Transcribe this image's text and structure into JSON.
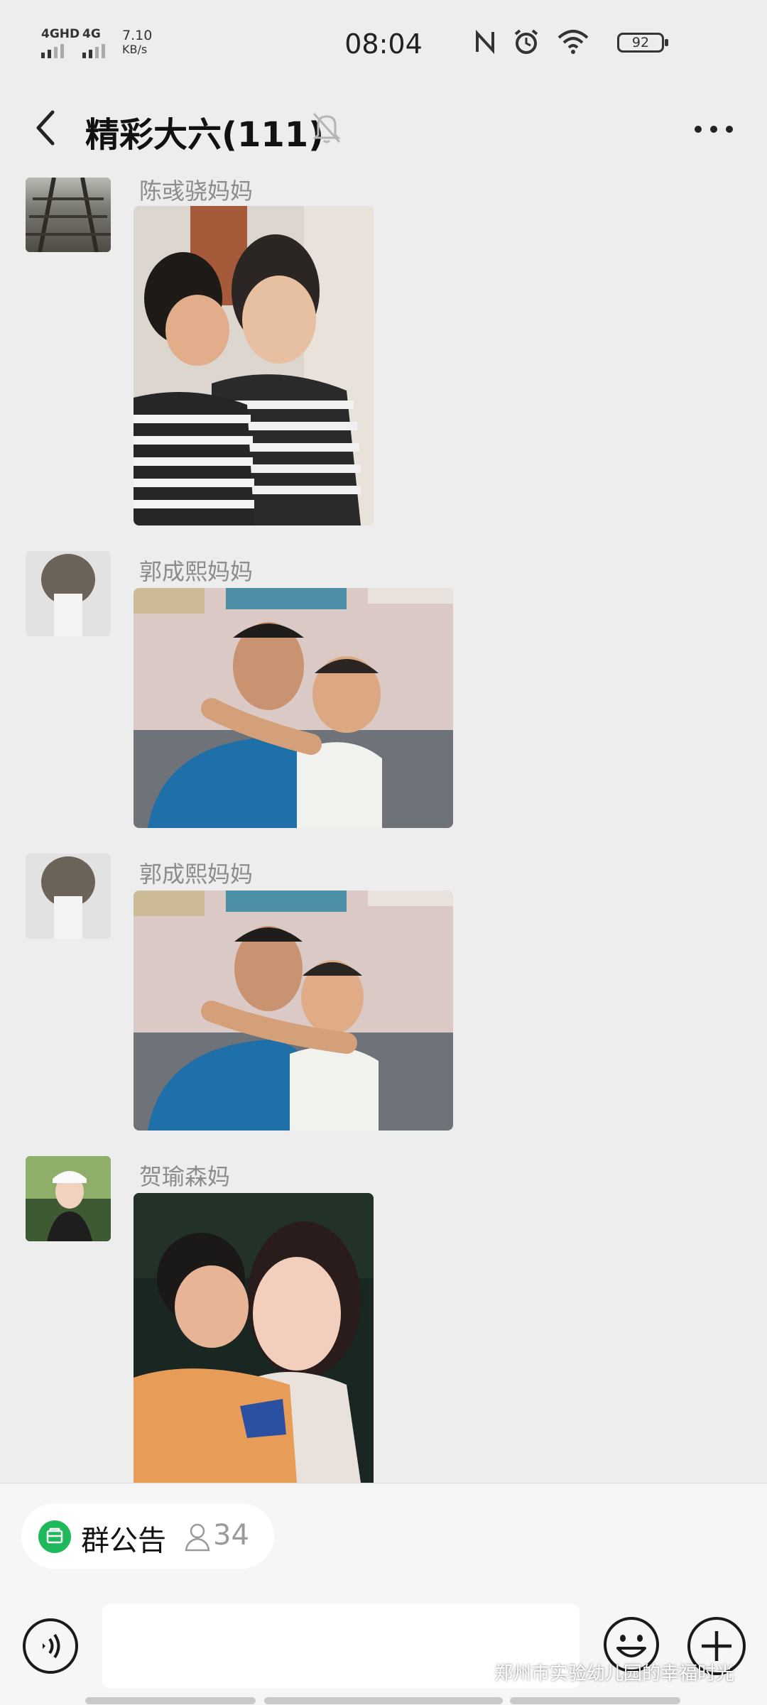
{
  "status_bar": {
    "signal1": "4GHD",
    "signal2": "4G",
    "speed_value": "7.10",
    "speed_unit": "KB/s",
    "time": "08:04",
    "battery": "92",
    "icons": [
      "nfc-icon",
      "alarm-icon",
      "wifi-icon"
    ]
  },
  "header": {
    "title": "精彩大六(111)",
    "icons": [
      "back-icon",
      "mute-bell-icon",
      "more-icon"
    ]
  },
  "messages": [
    {
      "sender": "陈彧骁妈妈",
      "type": "image",
      "image": "child kissing mother in striped shirt"
    },
    {
      "sender": "郭成熙妈妈",
      "type": "image",
      "image": "child kissing father in blue shirt"
    },
    {
      "sender": "郭成熙妈妈",
      "type": "image",
      "image": "child hugging father in blue shirt"
    },
    {
      "sender": "贺瑜森妈",
      "type": "image",
      "image": "child kissing mother in dark room"
    }
  ],
  "group_notice": {
    "label": "群公告",
    "member_count": "34"
  },
  "input_bar": {
    "icons": [
      "voice-icon",
      "emoji-icon",
      "plus-icon"
    ]
  },
  "watermark": {
    "text": "郑州市实验幼儿园的幸福时光"
  },
  "colors": {
    "background": "#ededed",
    "accent_green": "#1fb85a"
  }
}
